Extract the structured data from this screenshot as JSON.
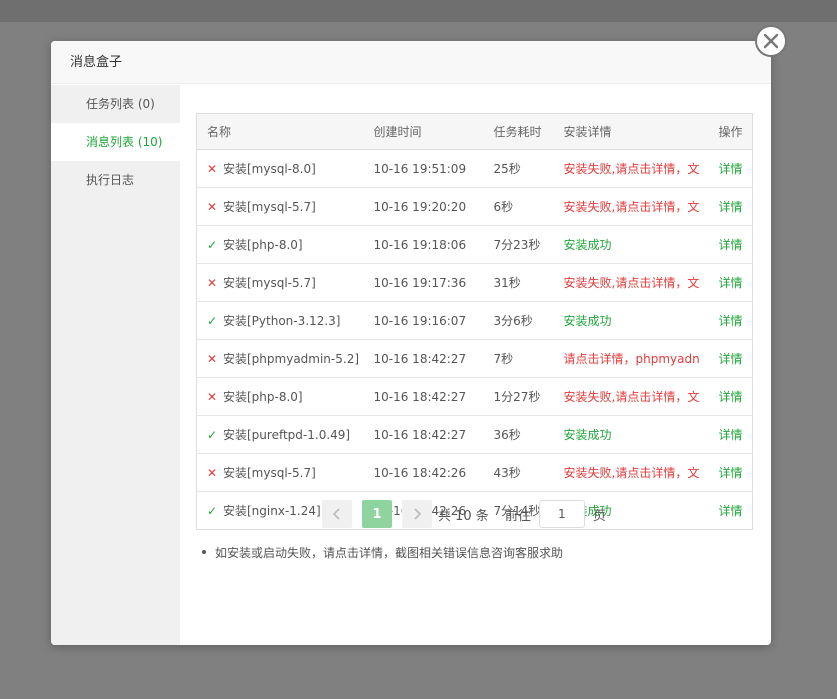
{
  "dialog": {
    "title": "消息盒子"
  },
  "sidebar": {
    "items": [
      {
        "label": "任务列表 (0)"
      },
      {
        "label": "消息列表 (10)"
      },
      {
        "label": "执行日志"
      }
    ]
  },
  "table": {
    "headers": [
      "名称",
      "创建时间",
      "任务耗时",
      "安装详情",
      "操作"
    ],
    "rows": [
      {
        "status": "fail",
        "name": "安装[mysql-8.0]",
        "time": "10-16 19:51:09",
        "duration": "25秒",
        "detail": "安装失败,请点击详情，文",
        "op": "详情"
      },
      {
        "status": "fail",
        "name": "安装[mysql-5.7]",
        "time": "10-16 19:20:20",
        "duration": "6秒",
        "detail": "安装失败,请点击详情，文",
        "op": "详情"
      },
      {
        "status": "ok",
        "name": "安装[php-8.0]",
        "time": "10-16 19:18:06",
        "duration": "7分23秒",
        "detail": "安装成功",
        "op": "详情"
      },
      {
        "status": "fail",
        "name": "安装[mysql-5.7]",
        "time": "10-16 19:17:36",
        "duration": "31秒",
        "detail": "安装失败,请点击详情，文",
        "op": "详情"
      },
      {
        "status": "ok",
        "name": "安装[Python-3.12.3]",
        "time": "10-16 19:16:07",
        "duration": "3分6秒",
        "detail": "安装成功",
        "op": "详情"
      },
      {
        "status": "fail",
        "name": "安装[phpmyadmin-5.2]",
        "time": "10-16 18:42:27",
        "duration": "7秒",
        "detail": "请点击详情，phpmyadn",
        "op": "详情"
      },
      {
        "status": "fail",
        "name": "安装[php-8.0]",
        "time": "10-16 18:42:27",
        "duration": "1分27秒",
        "detail": "安装失败,请点击详情，文",
        "op": "详情"
      },
      {
        "status": "ok",
        "name": "安装[pureftpd-1.0.49]",
        "time": "10-16 18:42:27",
        "duration": "36秒",
        "detail": "安装成功",
        "op": "详情"
      },
      {
        "status": "fail",
        "name": "安装[mysql-5.7]",
        "time": "10-16 18:42:26",
        "duration": "43秒",
        "detail": "安装失败,请点击详情，文",
        "op": "详情"
      },
      {
        "status": "ok",
        "name": "安装[nginx-1.24]",
        "time": "10-16 18:42:26",
        "duration": "7分14秒",
        "detail": "安装成功",
        "op": "详情"
      }
    ]
  },
  "note": "如安装或启动失败，请点击详情，截图相关错误信息咨询客服求助",
  "pager": {
    "current": "1",
    "total": "共 10 条",
    "goto_label": "前往",
    "goto_value": "1",
    "page_label": "页"
  },
  "colors": {
    "accent": "#20a53a",
    "error": "#e23b3b"
  },
  "icons": {
    "fail": "cross-icon",
    "ok": "check-icon",
    "close": "close-icon",
    "prev": "chevron-left-icon",
    "next": "chevron-right-icon"
  }
}
